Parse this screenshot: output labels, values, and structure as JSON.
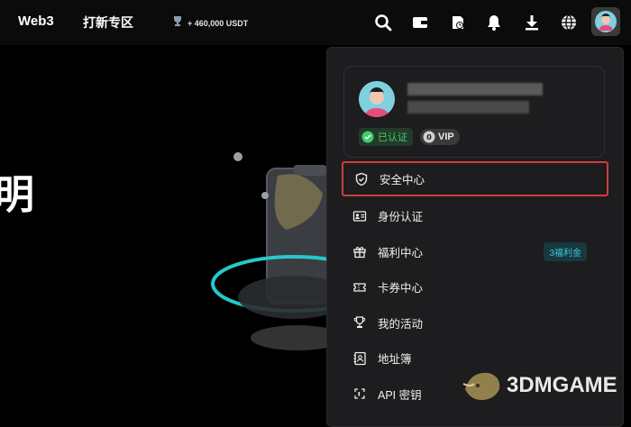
{
  "topbar": {
    "brand": "Web3",
    "nav_link": "打新专区",
    "prize_text": "+ 460,000 USDT",
    "icons": [
      "search-icon",
      "wallet-icon",
      "history-icon",
      "bell-icon",
      "download-icon",
      "globe-icon",
      "avatar"
    ]
  },
  "hero": {
    "glyph": "明"
  },
  "profile": {
    "verified_label": "已认证",
    "vip_label": "VIP"
  },
  "menu": {
    "items": [
      {
        "label": "安全中心",
        "icon": "shield-icon"
      },
      {
        "label": "身份认证",
        "icon": "id-card-icon"
      },
      {
        "label": "福利中心",
        "icon": "gift-icon",
        "tag": "3福利金"
      },
      {
        "label": "卡券中心",
        "icon": "ticket-icon"
      },
      {
        "label": "我的活动",
        "icon": "trophy-icon"
      },
      {
        "label": "地址簿",
        "icon": "address-book-icon"
      },
      {
        "label": "API 密钥",
        "icon": "api-icon"
      }
    ]
  },
  "watermark": {
    "text": "3DMGAME"
  },
  "colors": {
    "highlight": "#d23b3b",
    "accent": "#3dc8d6",
    "verified": "#3ecf6a"
  }
}
